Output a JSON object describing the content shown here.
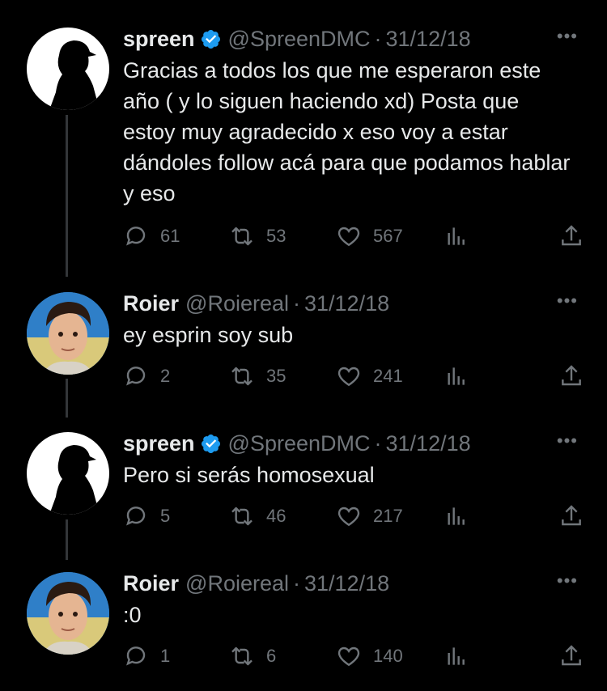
{
  "tweets": [
    {
      "name": "spreen",
      "verified": true,
      "handle": "@SpreenDMC",
      "date": "31/12/18",
      "text": "Gracias a todos los que me esperaron este año ( y lo siguen haciendo xd) Posta que estoy muy agradecido x eso voy a estar dándoles follow acá para que podamos hablar y eso",
      "replies": "61",
      "retweets": "53",
      "likes": "567"
    },
    {
      "name": "Roier",
      "verified": false,
      "handle": "@Roiereal",
      "date": "31/12/18",
      "text": "ey esprin soy sub",
      "replies": "2",
      "retweets": "35",
      "likes": "241"
    },
    {
      "name": "spreen",
      "verified": true,
      "handle": "@SpreenDMC",
      "date": "31/12/18",
      "text": "Pero si serás homosexual",
      "replies": "5",
      "retweets": "46",
      "likes": "217"
    },
    {
      "name": "Roier",
      "verified": false,
      "handle": "@Roiereal",
      "date": "31/12/18",
      "text": ":0",
      "replies": "1",
      "retweets": "6",
      "likes": "140"
    }
  ],
  "separator": "·",
  "more_label": "•••",
  "colors": {
    "background": "#000000",
    "text": "#e7e9ea",
    "muted": "#71767b",
    "verified": "#1d9bf0",
    "thread_line": "#333639"
  },
  "icons": [
    "verified-badge-icon",
    "reply-icon",
    "retweet-icon",
    "like-icon",
    "views-icon",
    "share-icon",
    "more-icon"
  ]
}
